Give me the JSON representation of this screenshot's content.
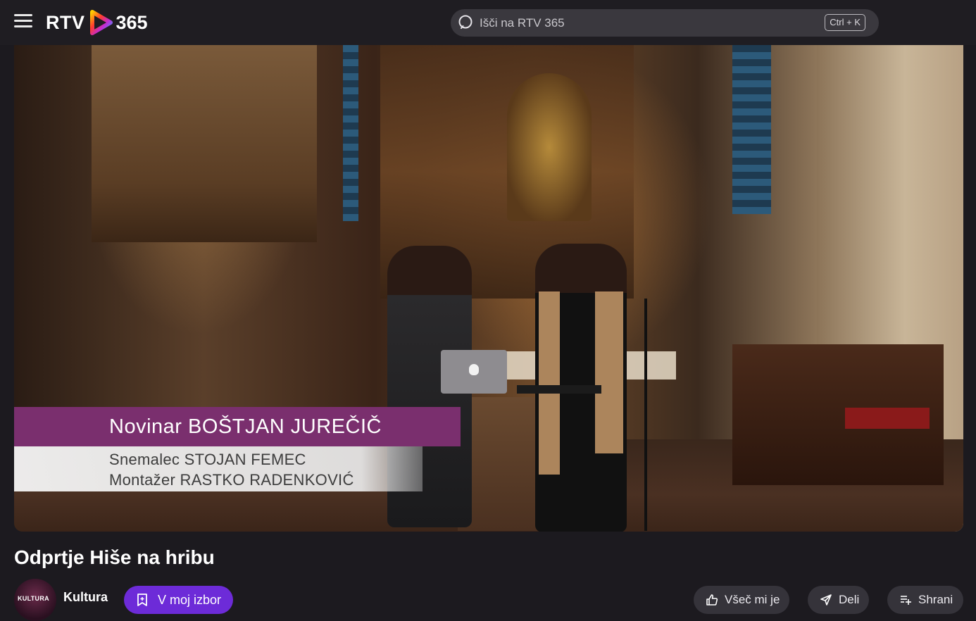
{
  "header": {
    "logo_text_left": "RTV",
    "logo_text_right": "365",
    "search_placeholder": "Išči na RTV 365",
    "search_shortcut": "Ctrl + K"
  },
  "video": {
    "lower_third": {
      "line1": "Novinar BOŠTJAN JUREČIČ",
      "line2": "Snemalec STOJAN FEMEC",
      "line3": "Montažer RASTKO RADENKOVIĆ"
    }
  },
  "content": {
    "title": "Odprtje Hiše na hribu",
    "channel": {
      "name": "Kultura",
      "avatar_text": "KULTURA"
    },
    "actions": {
      "add_to_list": "V moj izbor",
      "like": "Všeč mi je",
      "share": "Deli",
      "save": "Shrani"
    }
  },
  "colors": {
    "accent": "#6d2bd8",
    "lower_third_purple": "#7a2f6e",
    "background": "#1c1a1f"
  }
}
